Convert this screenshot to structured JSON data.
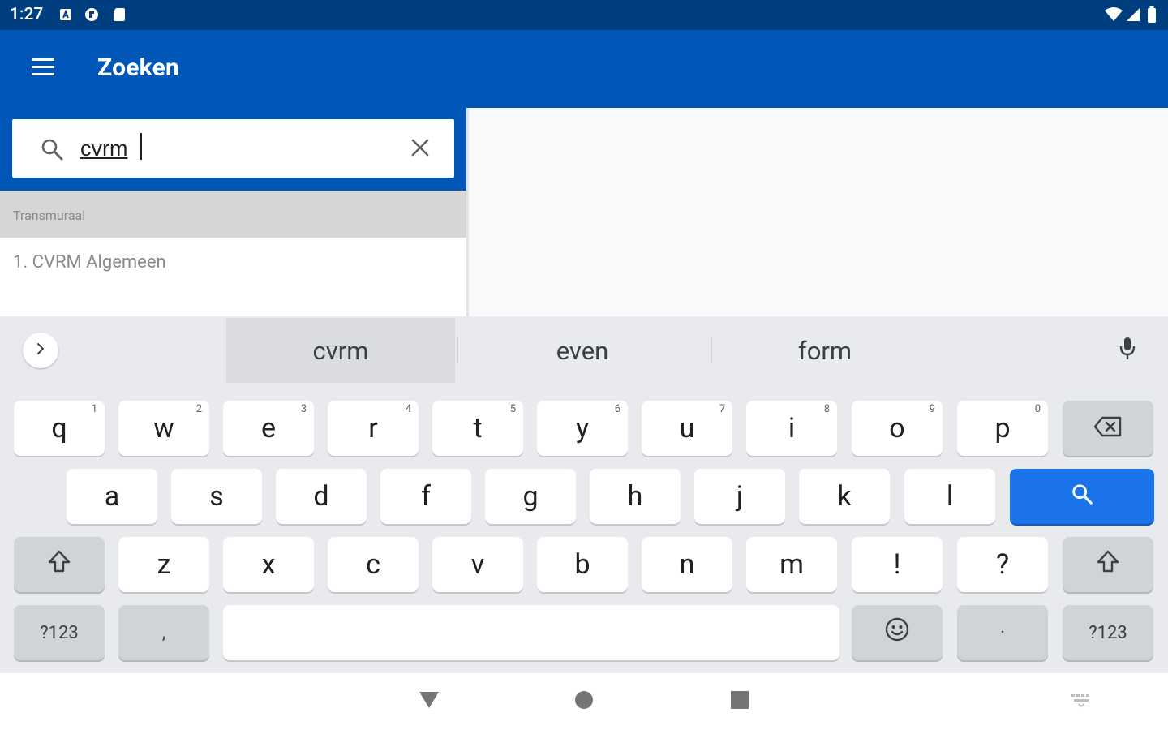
{
  "status_bar": {
    "time": "1:27",
    "icons": [
      "notification-a-icon",
      "flipboard-icon",
      "sd-card-icon"
    ],
    "right_icons": [
      "wifi-icon",
      "signal-icon",
      "battery-icon"
    ]
  },
  "app_bar": {
    "menu_icon": "menu-icon",
    "title": "Zoeken",
    "color": "#0057b7"
  },
  "search": {
    "value": "cvrm",
    "search_icon": "search-icon",
    "clear_icon": "close-icon"
  },
  "results": {
    "section_label": "Transmuraal",
    "items": [
      {
        "label": "1. CVRM Algemeen"
      }
    ]
  },
  "keyboard": {
    "suggestions": [
      "cvrm",
      "even",
      "form"
    ],
    "row1": [
      {
        "label": "q",
        "hint": "1"
      },
      {
        "label": "w",
        "hint": "2"
      },
      {
        "label": "e",
        "hint": "3"
      },
      {
        "label": "r",
        "hint": "4"
      },
      {
        "label": "t",
        "hint": "5"
      },
      {
        "label": "y",
        "hint": "6"
      },
      {
        "label": "u",
        "hint": "7"
      },
      {
        "label": "i",
        "hint": "8"
      },
      {
        "label": "o",
        "hint": "9"
      },
      {
        "label": "p",
        "hint": "0"
      }
    ],
    "row2": [
      "a",
      "s",
      "d",
      "f",
      "g",
      "h",
      "j",
      "k",
      "l"
    ],
    "row3": [
      "z",
      "x",
      "c",
      "v",
      "b",
      "n",
      "m",
      "!",
      "?"
    ],
    "symbols_label": "?123",
    "comma_label": ",",
    "period_label": "·",
    "accent_color": "#1a73e8"
  },
  "nav_bar": {
    "icons": [
      "back-icon",
      "home-icon",
      "recents-icon",
      "keyboard-switch-icon"
    ]
  }
}
